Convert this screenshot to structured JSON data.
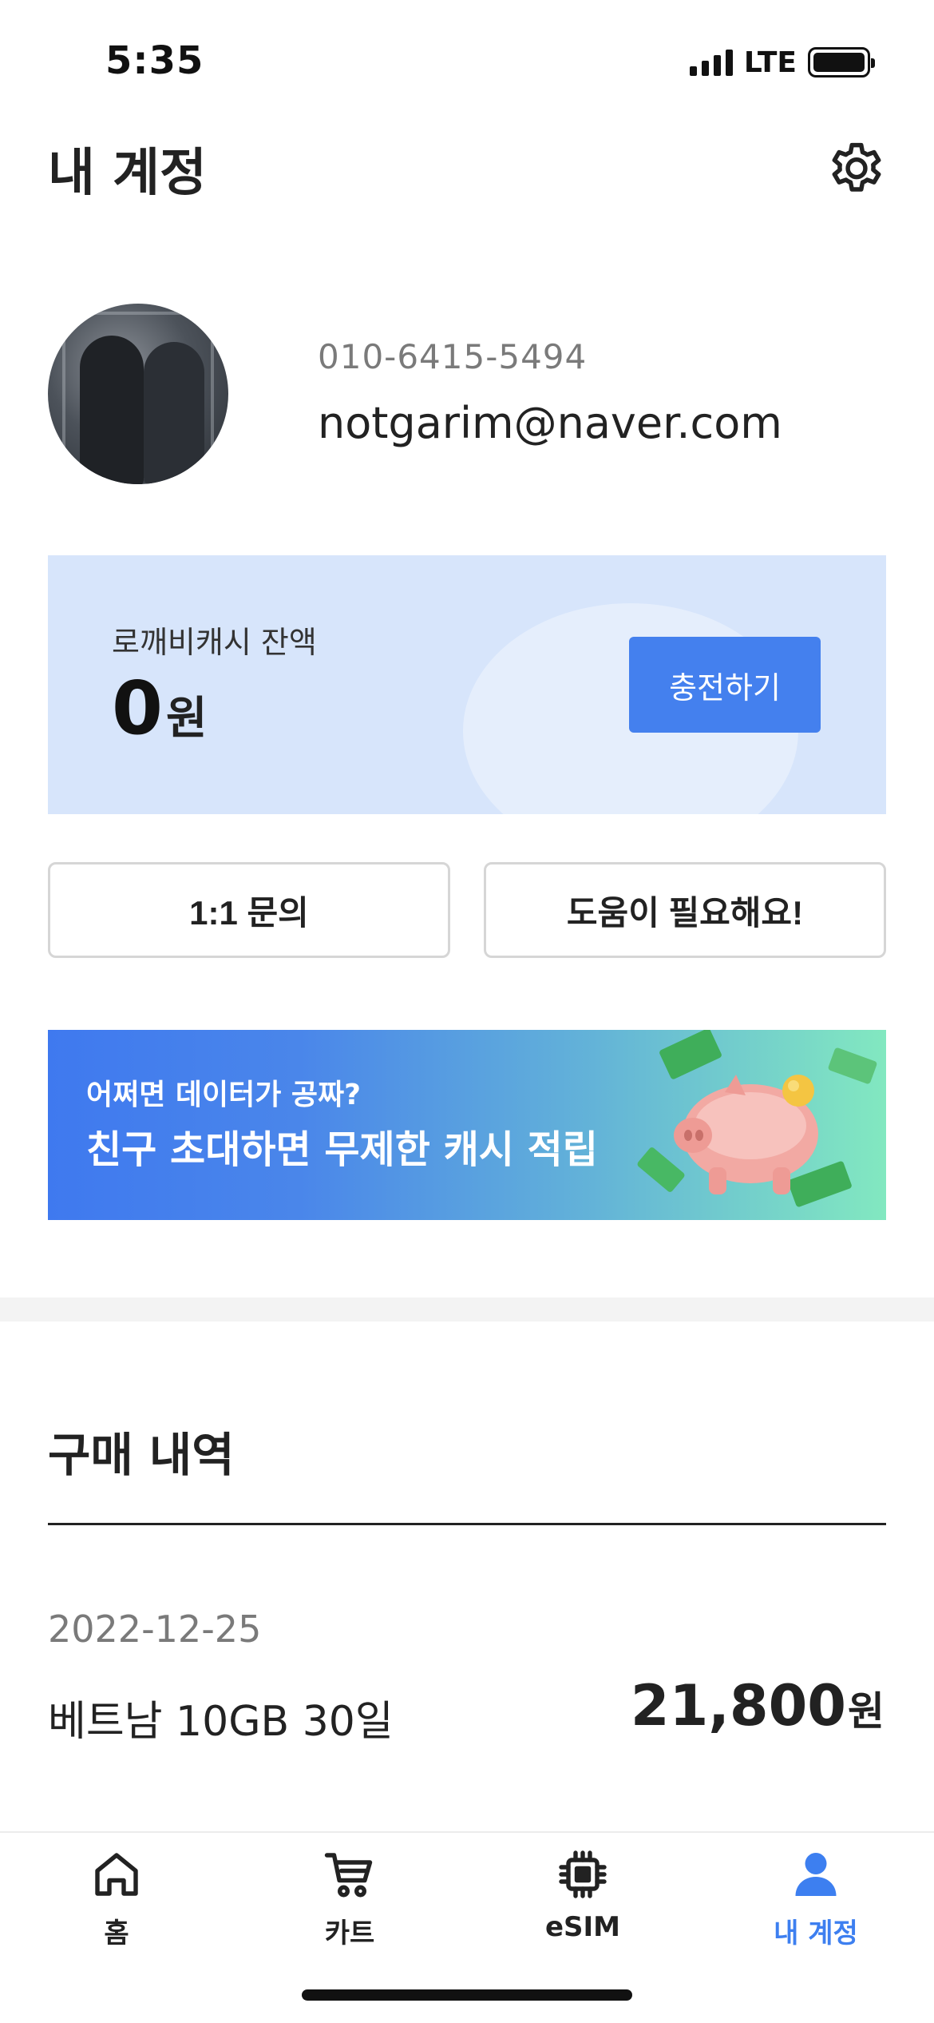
{
  "status_bar": {
    "time": "5:35",
    "network": "LTE"
  },
  "header": {
    "title": "내 계정",
    "settings_icon": "gear-icon"
  },
  "profile": {
    "phone": "010-6415-5494",
    "email": "notgarim@naver.com"
  },
  "cash": {
    "label": "로깨비캐시 잔액",
    "amount": "0",
    "unit": "원",
    "charge_button": "충전하기"
  },
  "actions": {
    "inquiry": "1:1 문의",
    "help": "도움이 필요해요!"
  },
  "promo": {
    "subtitle": "어쩌면 데이터가 공짜?",
    "title": "친구 초대하면 무제한 캐시 적립"
  },
  "history": {
    "title": "구매 내역",
    "items": [
      {
        "date": "2022-12-25",
        "name": "베트남 10GB 30일",
        "price": "21,800",
        "unit": "원"
      }
    ]
  },
  "tabs": [
    {
      "label": "홈",
      "icon": "home-icon"
    },
    {
      "label": "카트",
      "icon": "cart-icon"
    },
    {
      "label": "eSIM",
      "icon": "chip-icon"
    },
    {
      "label": "내 계정",
      "icon": "person-icon",
      "active": true
    }
  ],
  "colors": {
    "accent": "#4480ee",
    "card_bg": "#d7e5fb",
    "active_tab": "#3d7ff0"
  }
}
